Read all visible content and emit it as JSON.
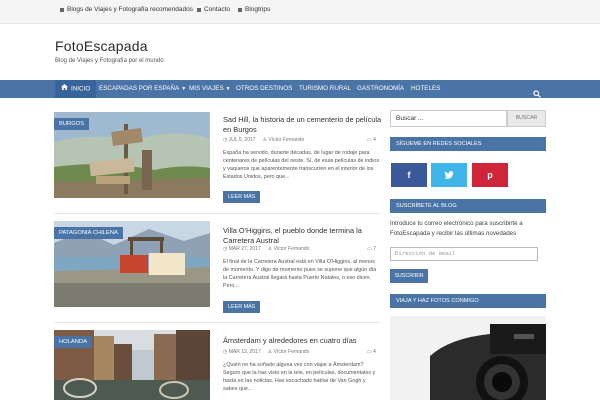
{
  "topbar": {
    "links": [
      "Blogs de Viajes y Fotografía recomendados",
      "Contacto",
      "Blogtrips"
    ]
  },
  "header": {
    "site_title": "FotoEscapada",
    "tagline": "Blog de Viajes y Fotografía por el mundo"
  },
  "nav": {
    "items": [
      {
        "label": "INICIO",
        "icon": "home-icon"
      },
      {
        "label": "ESCAPADAS POR ESPAÑA"
      },
      {
        "label": "MIS VIAJES"
      },
      {
        "label": "OTROS DESTINOS"
      },
      {
        "label": "TURISMO RURAL"
      },
      {
        "label": "GASTRONOMÍA"
      },
      {
        "label": "HOTELES"
      }
    ],
    "search_icon": "search-icon"
  },
  "posts": [
    {
      "category": "BURGOS",
      "title": "Sad Hill, la historia de un cementerio de película en Burgos",
      "date": "JUL 5, 2017",
      "author": "Víctor Fernando",
      "comments": "4",
      "excerpt": "España ha servido, durante décadas, de lugar de rodaje para centenares de películas del oeste. Sí, de esas películas de indios y vaqueros que aparentemente transcurren en el interior de los Estados Unidos, pero que...",
      "more": "LEER MÁS"
    },
    {
      "category": "PATAGONIA CHILENA",
      "title": "Villa O'Higgins, el pueblo donde termina la Carretera Austral",
      "date": "MAR 27, 2017",
      "author": "Víctor Fernando",
      "comments": "7",
      "excerpt": "El final de la Carretera Austral está en Villa O'Higgins, al menos de momento. Y digo de momento pues se supone que algún día la Carretera Austral llegará hasta Puerto Natales, o eso dicen. Pero...",
      "more": "LEER MÁS"
    },
    {
      "category": "HOLANDA",
      "title": "Ámsterdam y alrededores en cuatro días",
      "date": "MAR 13, 2017",
      "author": "Víctor Fernando",
      "comments": "4",
      "excerpt": "¿Quién no ha soñado alguna vez con viajar a Ámsterdam? Seguro que la has visto en la tele, en películas, documentales y hasta en las noticias. Has escuchado hablar de Van Gogh y sabes que...",
      "more": ""
    }
  ],
  "sidebar": {
    "search_placeholder": "Buscar ...",
    "search_button": "BUSCAR",
    "social_title": "SÍGUEME EN REDES SOCIALES",
    "subscribe_title": "SUSCRÍBETE AL BLOG",
    "subscribe_text": "Introduce tu correo electrónico para suscribirte a FotoEscapada y recibir las últimas novedades",
    "email_placeholder": "Dirección de email",
    "subscribe_button": "SUSCRIBIR",
    "photo_title": "VIAJA Y HAZ FOTOS CONMIGO",
    "social": [
      {
        "name": "facebook-icon",
        "glyph": "f",
        "color": "#3b5998"
      },
      {
        "name": "twitter-icon",
        "glyph": "t",
        "color": "#3fb5ea"
      },
      {
        "name": "pinterest-icon",
        "glyph": "p",
        "color": "#d0243b"
      }
    ]
  },
  "colors": {
    "accent": "#4a73a6",
    "accent_dark": "#37649a"
  }
}
